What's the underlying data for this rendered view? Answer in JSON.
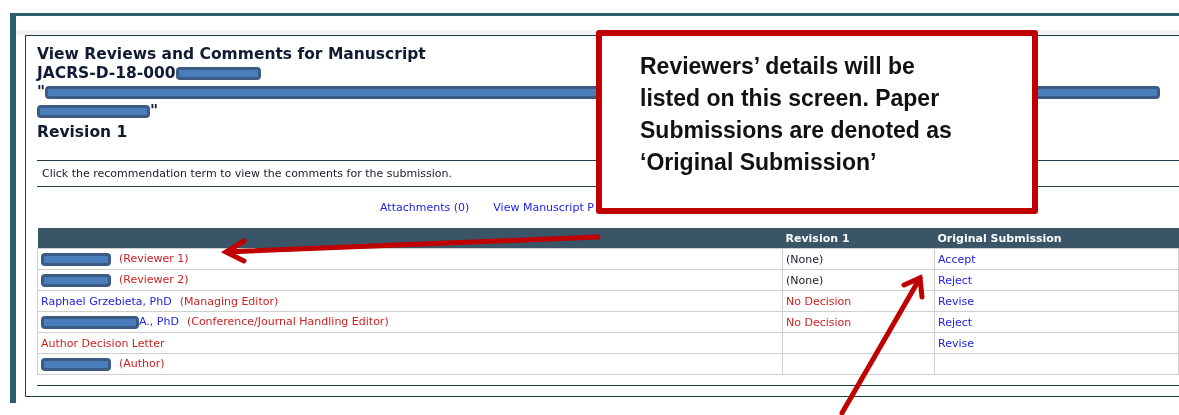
{
  "heading": {
    "title": "View Reviews and Comments for Manuscript",
    "manuscript_number": "JACRS-D-18-000",
    "quote_open": "\"",
    "quote_close": "\"",
    "revision": "Revision 1"
  },
  "instruction": "Click the recommendation term to view the comments for the submission.",
  "links": [
    "Attachments (0)",
    "View Manuscript P"
  ],
  "table": {
    "columns": [
      "Revision 1",
      "Original Submission"
    ],
    "rows": [
      {
        "kind": "person",
        "redacted": true,
        "role": "(Reviewer 1)",
        "revision_1": {
          "text": "(None)",
          "kind": "plain"
        },
        "original_submission": "Accept"
      },
      {
        "kind": "person",
        "redacted": true,
        "role": "(Reviewer 2)",
        "revision_1": {
          "text": "(None)",
          "kind": "plain"
        },
        "original_submission": "Reject"
      },
      {
        "kind": "person",
        "redacted": false,
        "name": "Raphael Grzebieta, PhD",
        "role": "(Managing Editor)",
        "revision_1": {
          "text": "No Decision",
          "kind": "alert"
        },
        "original_submission": "Revise"
      },
      {
        "kind": "person",
        "redacted": true,
        "name": "A., PhD",
        "role": "(Conference/Journal Handling Editor)",
        "revision_1": {
          "text": "No Decision",
          "kind": "alert"
        },
        "original_submission": "Reject"
      },
      {
        "kind": "letter",
        "redacted": false,
        "name": "Author Decision Letter",
        "original_submission": "Revise"
      },
      {
        "kind": "person",
        "redacted": true,
        "role": "(Author)"
      }
    ]
  },
  "callout": {
    "text": "Reviewers’ details will be listed on this screen. Paper Submissions are denoted as ‘Original Submission’"
  }
}
